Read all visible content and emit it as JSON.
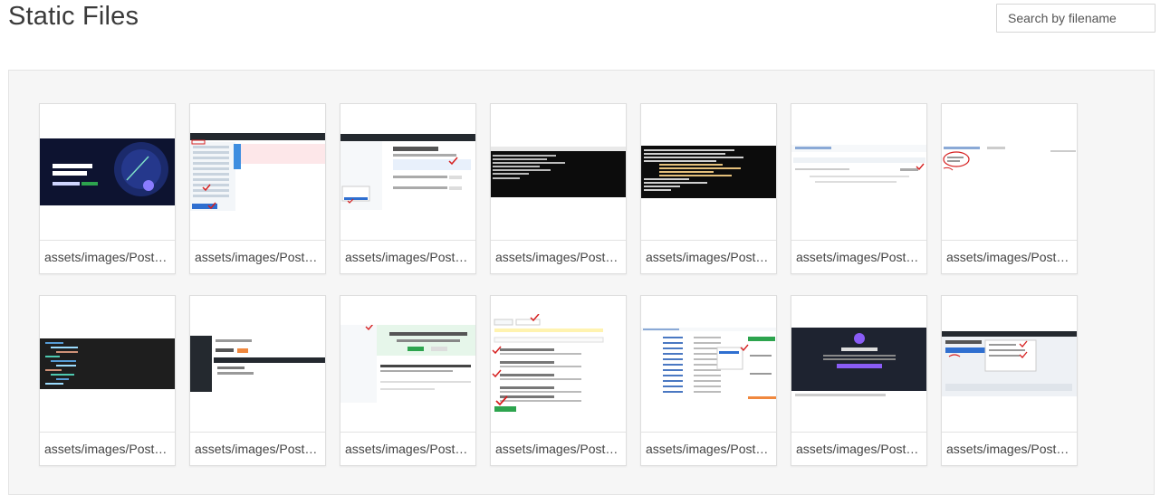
{
  "page": {
    "title": "Static Files"
  },
  "search": {
    "placeholder": "Search by filename",
    "value": ""
  },
  "files": [
    {
      "name": "assets/images/Post1...",
      "thumb": "github-hero"
    },
    {
      "name": "assets/images/Post1...",
      "thumb": "file-list-marked"
    },
    {
      "name": "assets/images/Post1...",
      "thumb": "no-local-changes"
    },
    {
      "name": "assets/images/Post1...",
      "thumb": "terminal-window"
    },
    {
      "name": "assets/images/Post1...",
      "thumb": "terminal-colored"
    },
    {
      "name": "assets/images/Post1...",
      "thumb": "light-page-marked"
    },
    {
      "name": "assets/images/Post1...",
      "thumb": "light-page-circled"
    },
    {
      "name": "assets/images/Post1...",
      "thumb": "code-editor-dark"
    },
    {
      "name": "assets/images/Post1...",
      "thumb": "pages-settings"
    },
    {
      "name": "assets/images/Post1...",
      "thumb": "green-banner-page"
    },
    {
      "name": "assets/images/Post1...",
      "thumb": "repo-options-form"
    },
    {
      "name": "assets/images/Post1...",
      "thumb": "repo-file-table"
    },
    {
      "name": "assets/images/Post1...",
      "thumb": "github-desktop-dark"
    },
    {
      "name": "assets/images/Post1...",
      "thumb": "lets-get-started"
    }
  ],
  "colors": {
    "panel_bg": "#f6f6f6",
    "tile_border": "#dedede",
    "annotation_red": "#d62020"
  }
}
